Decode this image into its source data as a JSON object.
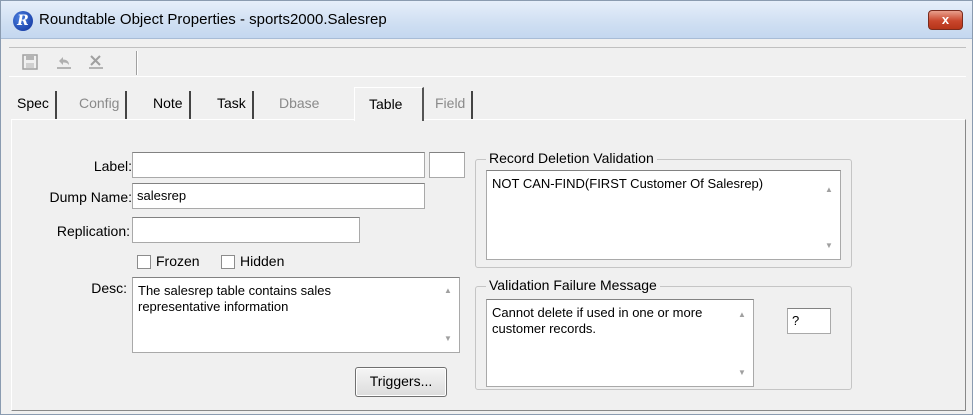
{
  "window": {
    "title": "Roundtable Object Properties - sports2000.Salesrep",
    "app_icon_letter": "R",
    "close_symbol": "x"
  },
  "toolbar": {
    "save_icon": "save-icon",
    "undo_icon": "undo-icon",
    "delete_icon": "delete-icon"
  },
  "tabs": [
    {
      "label": "Spec",
      "state": "enabled"
    },
    {
      "label": "Config",
      "state": "disabled"
    },
    {
      "label": "Note",
      "state": "enabled"
    },
    {
      "label": "Task",
      "state": "enabled"
    },
    {
      "label": "Dbase",
      "state": "disabled"
    },
    {
      "label": "Table",
      "state": "active"
    },
    {
      "label": "Field",
      "state": "disabled"
    }
  ],
  "form": {
    "label_label": "Label:",
    "label_value": "",
    "dump_name_label": "Dump Name:",
    "dump_name_value": "salesrep",
    "replication_label": "Replication:",
    "replication_value": "",
    "frozen_label": "Frozen",
    "frozen_checked": false,
    "hidden_label": "Hidden",
    "hidden_checked": false,
    "desc_label": "Desc:",
    "desc_line1": "The salesrep table contains sales",
    "desc_line2": "representative information",
    "triggers_label": "Triggers..."
  },
  "record_deletion": {
    "title": "Record Deletion Validation",
    "value": "NOT CAN-FIND(FIRST Customer Of Salesrep)"
  },
  "validation_failure": {
    "title": "Validation Failure Message",
    "line1": "Cannot delete if used in one or more",
    "line2": "customer records.",
    "help_value": "?"
  }
}
